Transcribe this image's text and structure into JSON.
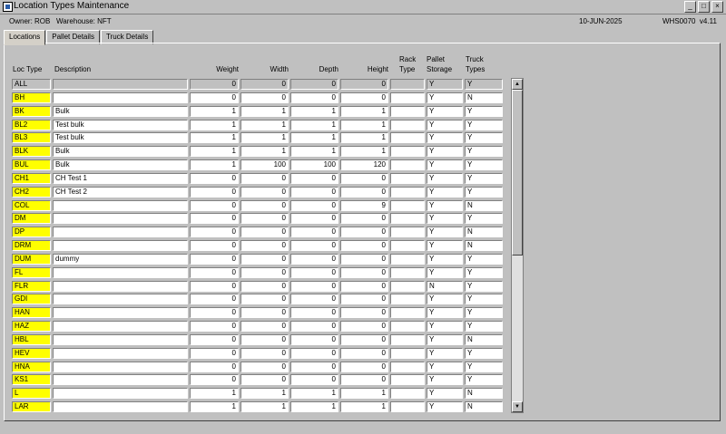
{
  "window": {
    "title": "Location Types Maintenance",
    "minimize_label": "_",
    "maximize_label": "□",
    "close_label": "×"
  },
  "info": {
    "owner_label": "Owner:",
    "owner": "ROB",
    "warehouse_label": "Warehouse:",
    "warehouse": "NFT",
    "date": "10-JUN-2025",
    "screen_id": "WHS0070",
    "version": "v4.11"
  },
  "tabs": [
    {
      "label": "Locations",
      "active": true
    },
    {
      "label": "Pallet Details",
      "active": false
    },
    {
      "label": "Truck Details",
      "active": false
    }
  ],
  "table": {
    "headers": {
      "loc_type": "Loc Type",
      "description": "Description",
      "weight": "Weight",
      "width": "Width",
      "depth": "Depth",
      "height": "Height",
      "rack_type_1": "Rack",
      "rack_type_2": "Type",
      "pallet_storage_1": "Pallet",
      "pallet_storage_2": "Storage",
      "truck_types_1": "Truck",
      "truck_types_2": "Types"
    },
    "all_row": {
      "code": "ALL",
      "description": "",
      "weight": "0",
      "width": "0",
      "depth": "0",
      "height": "0",
      "rack": "",
      "pallet": "Y",
      "truck": "Y"
    },
    "rows": [
      {
        "code": "BH",
        "description": "",
        "weight": "0",
        "width": "0",
        "depth": "0",
        "height": "0",
        "rack": "",
        "pallet": "Y",
        "truck": "N"
      },
      {
        "code": "BK",
        "description": "Bulk",
        "weight": "1",
        "width": "1",
        "depth": "1",
        "height": "1",
        "rack": "",
        "pallet": "Y",
        "truck": "Y"
      },
      {
        "code": "BL2",
        "description": "Test bulk",
        "weight": "1",
        "width": "1",
        "depth": "1",
        "height": "1",
        "rack": "",
        "pallet": "Y",
        "truck": "Y"
      },
      {
        "code": "BL3",
        "description": "Test bulk",
        "weight": "1",
        "width": "1",
        "depth": "1",
        "height": "1",
        "rack": "",
        "pallet": "Y",
        "truck": "Y"
      },
      {
        "code": "BLK",
        "description": "Bulk",
        "weight": "1",
        "width": "1",
        "depth": "1",
        "height": "1",
        "rack": "",
        "pallet": "Y",
        "truck": "Y"
      },
      {
        "code": "BUL",
        "description": "Bulk",
        "weight": "1",
        "width": "100",
        "depth": "100",
        "height": "120",
        "rack": "",
        "pallet": "Y",
        "truck": "Y"
      },
      {
        "code": "CH1",
        "description": "CH Test 1",
        "weight": "0",
        "width": "0",
        "depth": "0",
        "height": "0",
        "rack": "",
        "pallet": "Y",
        "truck": "Y"
      },
      {
        "code": "CH2",
        "description": "CH Test 2",
        "weight": "0",
        "width": "0",
        "depth": "0",
        "height": "0",
        "rack": "",
        "pallet": "Y",
        "truck": "Y"
      },
      {
        "code": "COL",
        "description": "",
        "weight": "0",
        "width": "0",
        "depth": "0",
        "height": "9",
        "rack": "",
        "pallet": "Y",
        "truck": "N"
      },
      {
        "code": "DM",
        "description": "",
        "weight": "0",
        "width": "0",
        "depth": "0",
        "height": "0",
        "rack": "",
        "pallet": "Y",
        "truck": "Y"
      },
      {
        "code": "DP",
        "description": "",
        "weight": "0",
        "width": "0",
        "depth": "0",
        "height": "0",
        "rack": "",
        "pallet": "Y",
        "truck": "N"
      },
      {
        "code": "DRM",
        "description": "",
        "weight": "0",
        "width": "0",
        "depth": "0",
        "height": "0",
        "rack": "",
        "pallet": "Y",
        "truck": "N"
      },
      {
        "code": "DUM",
        "description": "dummy",
        "weight": "0",
        "width": "0",
        "depth": "0",
        "height": "0",
        "rack": "",
        "pallet": "Y",
        "truck": "Y"
      },
      {
        "code": "FL",
        "description": "",
        "weight": "0",
        "width": "0",
        "depth": "0",
        "height": "0",
        "rack": "",
        "pallet": "Y",
        "truck": "Y"
      },
      {
        "code": "FLR",
        "description": "",
        "weight": "0",
        "width": "0",
        "depth": "0",
        "height": "0",
        "rack": "",
        "pallet": "N",
        "truck": "Y"
      },
      {
        "code": "GDI",
        "description": "",
        "weight": "0",
        "width": "0",
        "depth": "0",
        "height": "0",
        "rack": "",
        "pallet": "Y",
        "truck": "Y"
      },
      {
        "code": "HAN",
        "description": "",
        "weight": "0",
        "width": "0",
        "depth": "0",
        "height": "0",
        "rack": "",
        "pallet": "Y",
        "truck": "Y"
      },
      {
        "code": "HAZ",
        "description": "",
        "weight": "0",
        "width": "0",
        "depth": "0",
        "height": "0",
        "rack": "",
        "pallet": "Y",
        "truck": "Y"
      },
      {
        "code": "HBL",
        "description": "",
        "weight": "0",
        "width": "0",
        "depth": "0",
        "height": "0",
        "rack": "",
        "pallet": "Y",
        "truck": "N"
      },
      {
        "code": "HEV",
        "description": "",
        "weight": "0",
        "width": "0",
        "depth": "0",
        "height": "0",
        "rack": "",
        "pallet": "Y",
        "truck": "Y"
      },
      {
        "code": "HNA",
        "description": "",
        "weight": "0",
        "width": "0",
        "depth": "0",
        "height": "0",
        "rack": "",
        "pallet": "Y",
        "truck": "Y"
      },
      {
        "code": "KS1",
        "description": "",
        "weight": "0",
        "width": "0",
        "depth": "0",
        "height": "0",
        "rack": "",
        "pallet": "Y",
        "truck": "Y"
      },
      {
        "code": "L",
        "description": "",
        "weight": "1",
        "width": "1",
        "depth": "1",
        "height": "1",
        "rack": "",
        "pallet": "Y",
        "truck": "N"
      },
      {
        "code": "LAR",
        "description": "",
        "weight": "1",
        "width": "1",
        "depth": "1",
        "height": "1",
        "rack": "",
        "pallet": "Y",
        "truck": "N"
      }
    ]
  },
  "scrollbar": {
    "up_icon": "▲",
    "down_icon": "▼"
  }
}
